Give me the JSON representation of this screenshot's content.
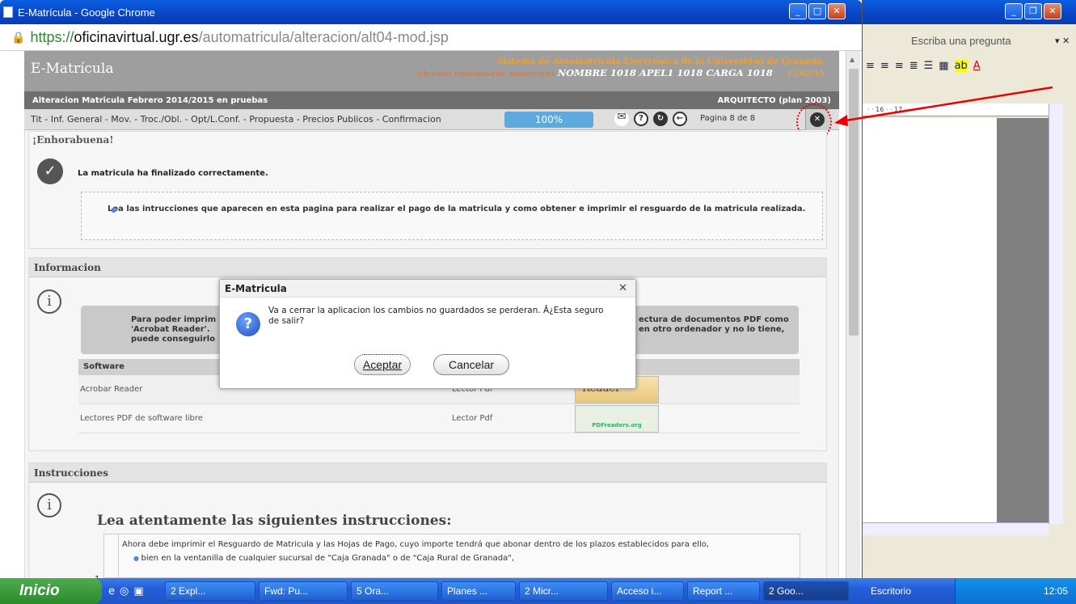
{
  "chrome": {
    "title": "E-Matrícula - Google Chrome",
    "url_scheme": "https://",
    "url_host": "oficinavirtual.ugr.es",
    "url_path": "/automatricula/alteracion/alt04-mod.jsp"
  },
  "header": {
    "brand": "E-Matrícula",
    "system": "Sistema de Automatrícula Electrónica de la Universidad de Granada.",
    "access": "(Acceso funcionario: subsurtra)",
    "who": "NOMBRE 1018 APEL1 1018 CARGA 1018",
    "date": "12/02/15"
  },
  "bar": {
    "left": "Alteracion Matricula Febrero 2014/2015 en pruebas",
    "right": "ARQUITECTO (plan 2003)",
    "steps": "Tit - Inf. General - Mov. - Troc./Obl. - Opt/L.Conf. - Propuesta - Precios Publicos - Confirmacion",
    "progress": "100%",
    "page": "Pagina 8 de 8"
  },
  "success": {
    "title": "¡Enhorabuena!",
    "message": "La matricula ha finalizado correctamente.",
    "note": "Lea las intrucciones que aparecen en esta pagina para realizar el pago de la matricula y como obtener e imprimir el resguardo de la matricula realizada."
  },
  "info": {
    "title": "Informacion",
    "left_text": "Para poder imprim 'Acrobat Reader'. puede conseguirlo",
    "right_text": "ectura de documentos PDF como en otro ordenador y no lo tiene,",
    "table_header": "Software",
    "rows": [
      {
        "name": "Acrobar Reader",
        "type": "Lector Pdf",
        "logo": "Reader"
      },
      {
        "name": "Lectores PDF de software libre",
        "type": "Lector Pdf",
        "logo": "PDFreaders.org"
      }
    ]
  },
  "instructions": {
    "title": "Instrucciones",
    "heading": "Lea atentamente las siguientes instrucciones:",
    "para": "Ahora debe imprimir el Resguardo de Matricula y las Hojas de Pago, cuyo importe tendrá que abonar dentro de los plazos establecidos para ello,",
    "bullet": "bien en la ventanilla de cualquier sucursal de \"Caja Granada\" o de \"Caja Rural de Granada\",",
    "row_num": "1"
  },
  "modal": {
    "title": "E-Matricula",
    "message": "Va a cerrar la aplicacion los cambios no guardados se perderan. Â¿Esta seguro de salir?",
    "ok": "Aceptar",
    "cancel": "Cancelar"
  },
  "word": {
    "ask": "Escriba una pregunta",
    "ruler": "· · 16 · · 17 · · ·"
  },
  "taskbar": {
    "start": "Inicio",
    "tasks": [
      "2 Expl...",
      "Fwd: Pu...",
      "5 Ora...",
      "Planes ...",
      "2 Micr...",
      "Acceso i...",
      "Report ...",
      "2 Goo..."
    ],
    "desktop": "Escritorio",
    "time": "12:05"
  },
  "colors": {
    "accent": "#5ba9dd",
    "header": "#9e9e9e",
    "highlight": "#e00000"
  }
}
